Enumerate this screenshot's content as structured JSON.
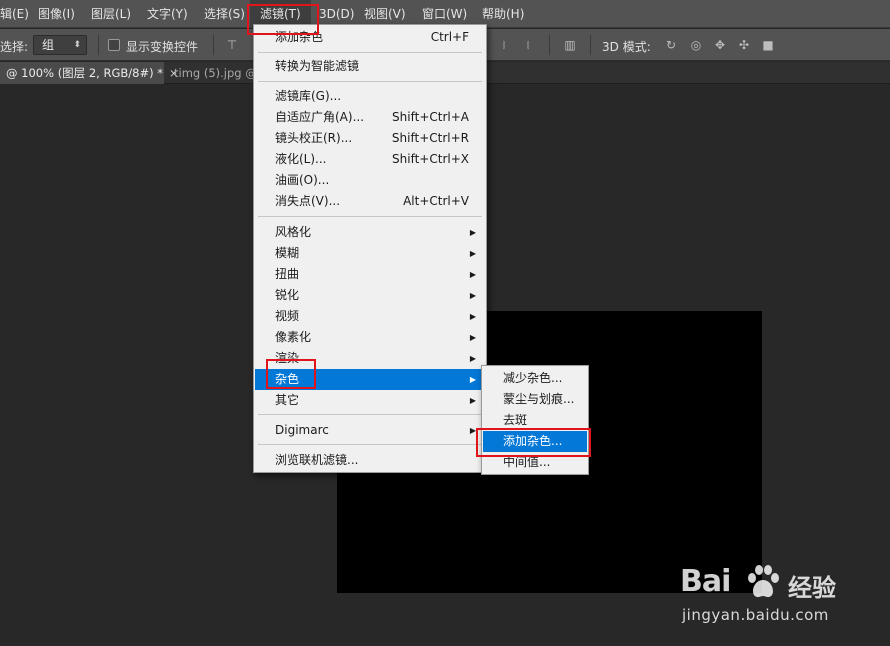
{
  "menubar": {
    "items": [
      {
        "label": "辑(E)"
      },
      {
        "label": "图像(I)"
      },
      {
        "label": "图层(L)"
      },
      {
        "label": "文字(Y)"
      },
      {
        "label": "选择(S)"
      },
      {
        "label": "滤镜(T)"
      },
      {
        "label": "3D(D)"
      },
      {
        "label": "视图(V)"
      },
      {
        "label": "窗口(W)"
      },
      {
        "label": "帮助(H)"
      }
    ]
  },
  "options": {
    "select_label": "选择:",
    "select_value": "组",
    "transform_controls": "显示变换控件",
    "mode_3d": "3D 模式:"
  },
  "tabs": [
    {
      "label": "@ 100% (图层 2, RGB/8#) *"
    },
    {
      "label": "timg (5).jpg @"
    }
  ],
  "tab_close": "×",
  "filter_menu": {
    "items": [
      {
        "label": "添加杂色",
        "shortcut": "Ctrl+F"
      },
      {
        "label": "转换为智能滤镜"
      },
      {
        "label": "滤镜库(G)..."
      },
      {
        "label": "自适应广角(A)...",
        "shortcut": "Shift+Ctrl+A"
      },
      {
        "label": "镜头校正(R)...",
        "shortcut": "Shift+Ctrl+R"
      },
      {
        "label": "液化(L)...",
        "shortcut": "Shift+Ctrl+X"
      },
      {
        "label": "油画(O)..."
      },
      {
        "label": "消失点(V)...",
        "shortcut": "Alt+Ctrl+V"
      },
      {
        "label": "风格化"
      },
      {
        "label": "模糊"
      },
      {
        "label": "扭曲"
      },
      {
        "label": "锐化"
      },
      {
        "label": "视频"
      },
      {
        "label": "像素化"
      },
      {
        "label": "渲染"
      },
      {
        "label": "杂色"
      },
      {
        "label": "其它"
      },
      {
        "label": "Digimarc"
      },
      {
        "label": "浏览联机滤镜..."
      }
    ]
  },
  "noise_submenu": {
    "items": [
      {
        "label": "减少杂色..."
      },
      {
        "label": "蒙尘与划痕..."
      },
      {
        "label": "去斑"
      },
      {
        "label": "添加杂色..."
      },
      {
        "label": "中间值..."
      }
    ]
  },
  "watermark": {
    "brand": "Bai",
    "brand_cn": "经验",
    "site": "jingyan.baidu.com"
  },
  "colors": {
    "highlight": "#0478d7",
    "annotation": "#e0141c",
    "menu_bg": "#f0f0f0",
    "app_bg": "#282828"
  }
}
